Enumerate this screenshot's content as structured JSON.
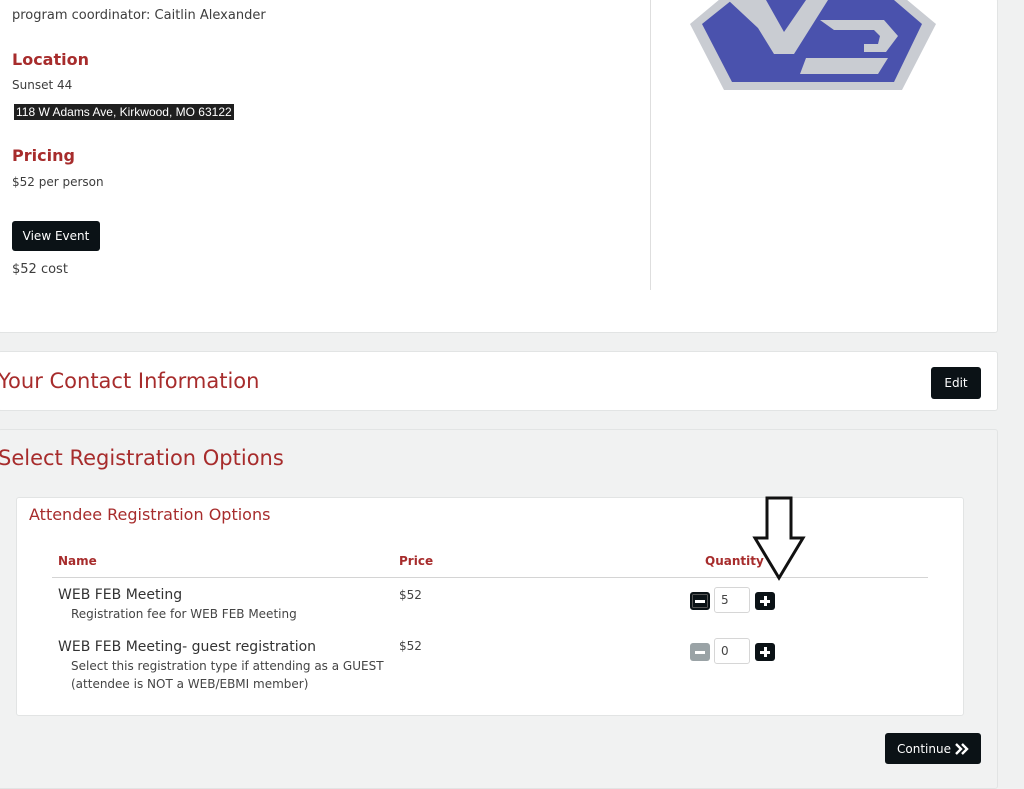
{
  "event": {
    "coordinator": "program coordinator:  Caitlin Alexander",
    "location_heading": "Location",
    "venue": "Sunset 44",
    "address": "118 W Adams Ave, Kirkwood, MO 63122",
    "pricing_heading": "Pricing",
    "price_per_person": "$52 per person",
    "view_event_label": "View Event",
    "cost": "$52 cost"
  },
  "contact": {
    "title": "Your Contact Information",
    "edit_label": "Edit"
  },
  "registration": {
    "title": "Select Registration Options",
    "panel_title": "Attendee Registration Options",
    "columns": {
      "name": "Name",
      "price": "Price",
      "quantity": "Quantity"
    },
    "rows": [
      {
        "name": "WEB FEB Meeting",
        "description": "Registration fee for WEB FEB Meeting",
        "price": "$52",
        "quantity": "5"
      },
      {
        "name": "WEB FEB Meeting- guest registration",
        "description_line1": "Select this registration type if attending as a GUEST",
        "description_line2": "(attendee is NOT a WEB/EBMI member)",
        "price": "$52",
        "quantity": "0"
      }
    ],
    "continue_label": "Continue"
  },
  "icons": {
    "logo": "web-logo",
    "arrow": "down-arrow-annotation-icon",
    "continue": "double-chevron-right-icon"
  },
  "colors": {
    "heading_red": "#a72c2c",
    "button_dark": "#0b1216",
    "logo_blue": "#4a52ad",
    "logo_gray": "#c9ccd2"
  }
}
